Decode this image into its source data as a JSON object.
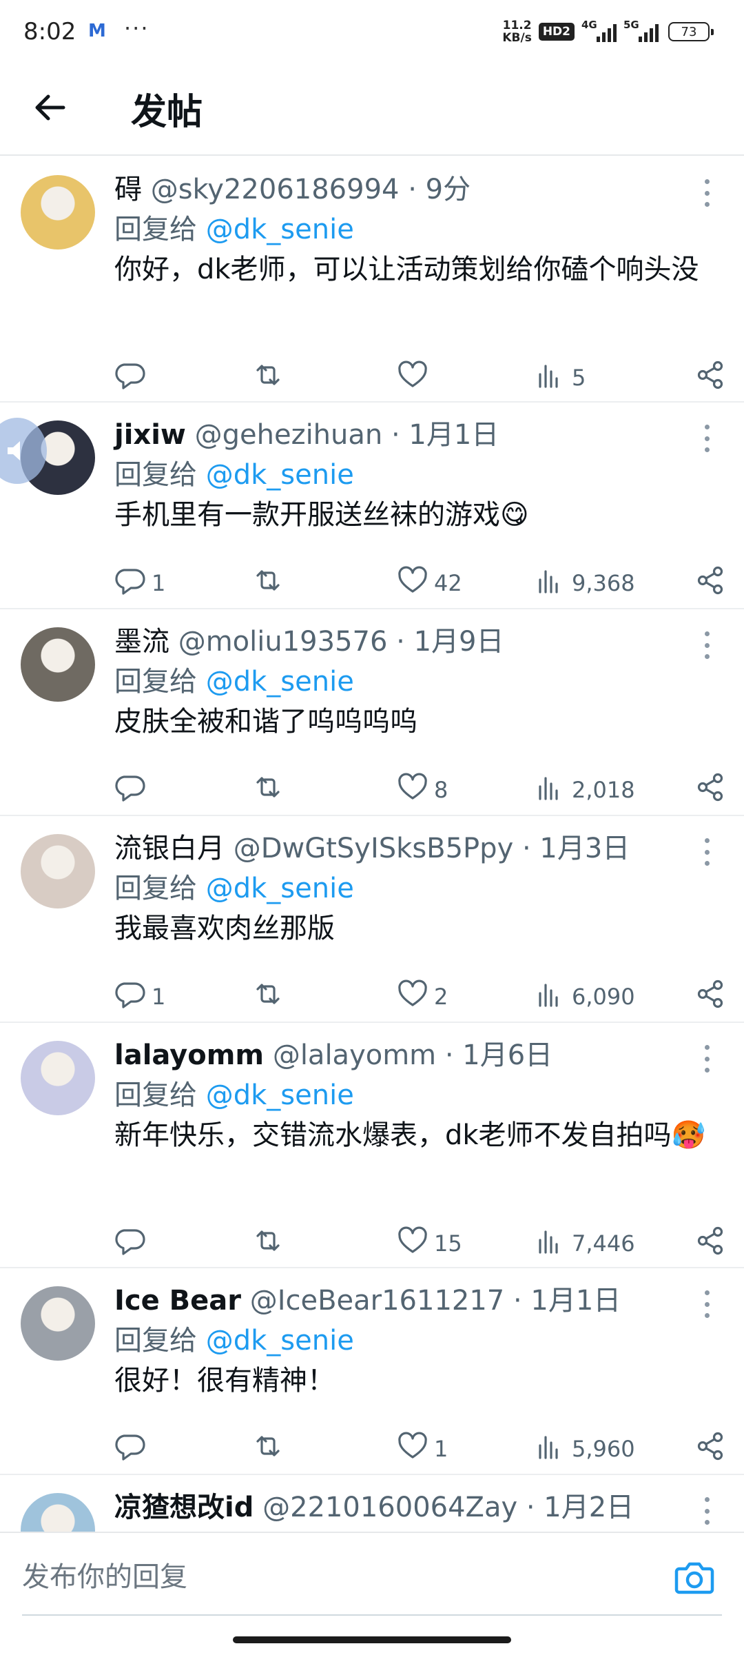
{
  "status_bar": {
    "time": "8:02",
    "mail_icon": "mail-icon",
    "more": "···",
    "net_speed_value": "11.2",
    "net_speed_unit": "KB/s",
    "hd_badge": "HD2",
    "signal_1": "4G",
    "signal_2": "5G",
    "battery": "73"
  },
  "header": {
    "title": "发帖"
  },
  "posts": [
    {
      "display_name": "碍",
      "handle": "@sky2206186994",
      "time": "· 9分",
      "reply_label": "回复给",
      "reply_mention": "@dk_senie",
      "text": "你好，dk老师，可以让活动策划给你磕个响头没",
      "replies": "",
      "likes": "",
      "views": "5",
      "avatar_color": "#e8c46a"
    },
    {
      "display_name": "jixiw",
      "handle": "@gehezihuan",
      "time": "· 1月1日",
      "reply_label": "回复给",
      "reply_mention": "@dk_senie",
      "text": "手机里有一款开服送丝袜的游戏😋",
      "replies": "1",
      "likes": "42",
      "views": "9,368",
      "avatar_color": "#2d3140"
    },
    {
      "display_name": "墨流",
      "handle": "@moliu193576",
      "time": "· 1月9日",
      "reply_label": "回复给",
      "reply_mention": "@dk_senie",
      "text": "皮肤全被和谐了呜呜呜呜",
      "replies": "",
      "likes": "8",
      "views": "2,018",
      "avatar_color": "#6f6a62"
    },
    {
      "display_name": "流银白月",
      "handle": "@DwGtSyISksB5Ppy",
      "time": "· 1月3日",
      "reply_label": "回复给",
      "reply_mention": "@dk_senie",
      "text": "我最喜欢肉丝那版",
      "replies": "1",
      "likes": "2",
      "views": "6,090",
      "avatar_color": "#d8ccc4"
    },
    {
      "display_name": "lalayomm",
      "handle": "@lalayomm",
      "time": "· 1月6日",
      "reply_label": "回复给",
      "reply_mention": "@dk_senie",
      "text": "新年快乐，交错流水爆表，dk老师不发自拍吗🥵",
      "replies": "",
      "likes": "15",
      "views": "7,446",
      "avatar_color": "#c9cbe6"
    },
    {
      "display_name": "Ice Bear",
      "handle": "@IceBear1611217",
      "time": "· 1月1日",
      "reply_label": "回复给",
      "reply_mention": "@dk_senie",
      "text": "很好！很有精神！",
      "replies": "",
      "likes": "1",
      "views": "5,960",
      "avatar_color": "#9aa0a8"
    },
    {
      "display_name": "凉猹想改id",
      "handle": "@2210160064Zay",
      "time": "· 1月2日",
      "reply_label": "",
      "reply_mention": "",
      "text": "",
      "replies": "",
      "likes": "",
      "views": "",
      "avatar_color": "#9fc3dc"
    }
  ],
  "compose": {
    "placeholder": "发布你的回复",
    "camera_icon": "camera-icon"
  },
  "colors": {
    "accent": "#1d9bf0",
    "secondary_text": "#536471",
    "primary_text": "#0f1419"
  }
}
